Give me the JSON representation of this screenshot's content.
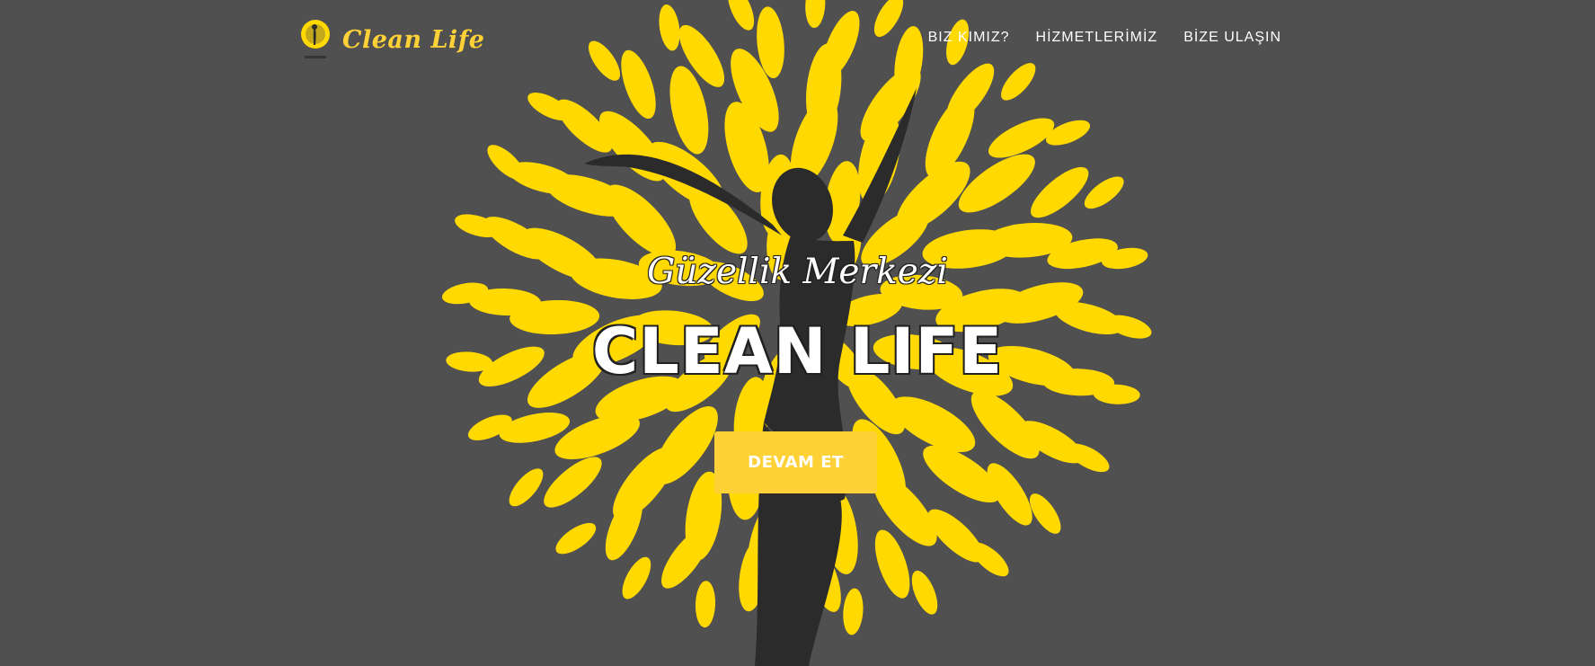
{
  "brand": {
    "name": "Clean Life"
  },
  "nav": {
    "items": [
      {
        "label": "BIZ KIMIZ?"
      },
      {
        "label": "HİZMETLERİMİZ"
      },
      {
        "label": "BİZE ULAŞIN"
      }
    ]
  },
  "hero": {
    "subtitle": "Güzellik Merkezi",
    "title": "CLEAN LIFE",
    "cta_label": "DEVAM ET"
  },
  "colors": {
    "background": "#505050",
    "accent": "#fed136",
    "leaf": "#ffd900",
    "silhouette": "#2b2b2b",
    "text": "#ffffff"
  },
  "icons": {
    "logo": "tree-woman-logo-icon"
  }
}
